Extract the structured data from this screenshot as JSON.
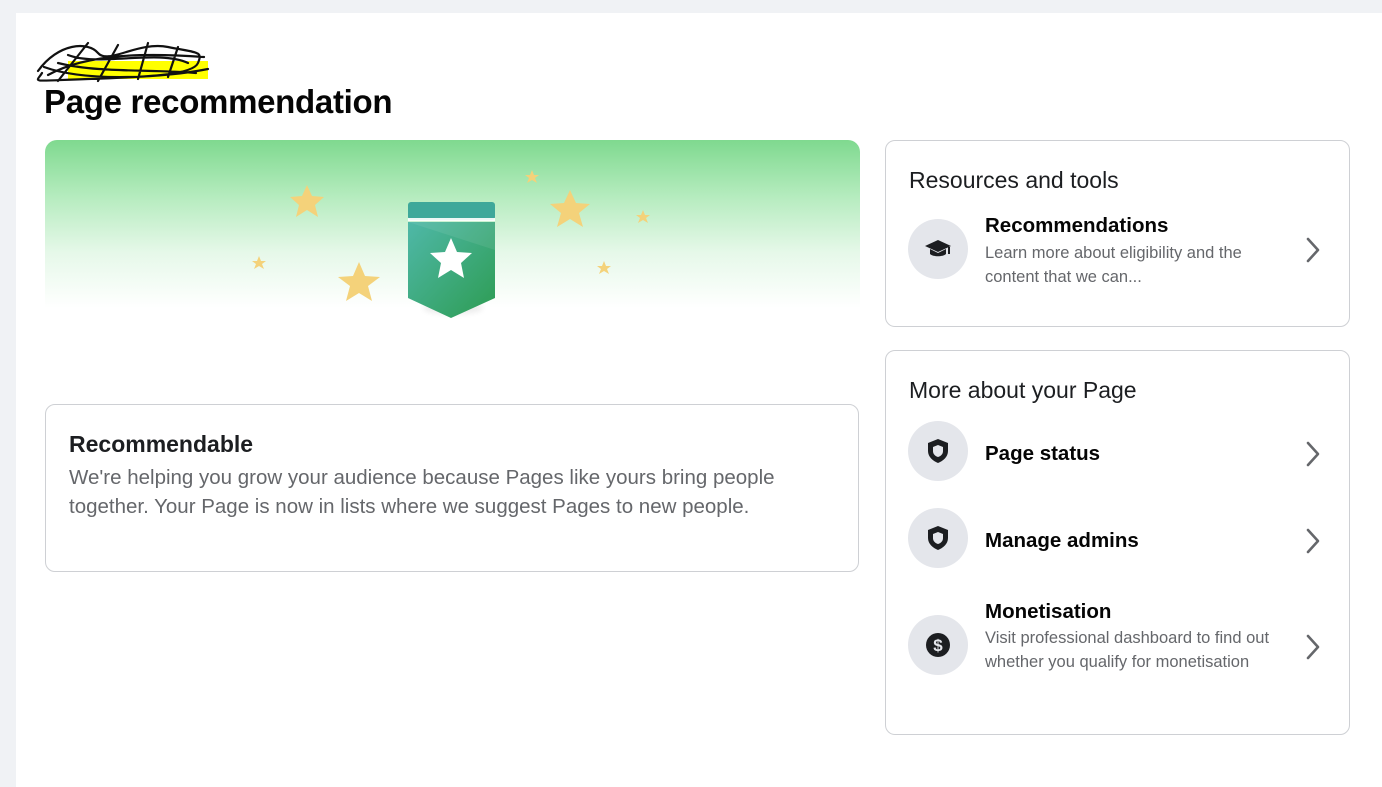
{
  "page": {
    "title": "Page recommendation"
  },
  "status_card": {
    "heading": "Recommendable",
    "body": "We're helping you grow your audience because Pages like yours bring people together. Your Page is now in lists where we suggest Pages to new people."
  },
  "resources": {
    "heading": "Resources and tools",
    "items": [
      {
        "title": "Recommendations",
        "description": "Learn more about eligibility and the content that we can...",
        "icon": "graduation-cap-icon"
      }
    ]
  },
  "more": {
    "heading": "More about your Page",
    "items": [
      {
        "title": "Page status",
        "icon": "shield-icon"
      },
      {
        "title": "Manage admins",
        "icon": "shield-icon"
      },
      {
        "title": "Monetisation",
        "description": "Visit professional dashboard to find out whether you qualify for monetisation",
        "icon": "dollar-icon"
      }
    ]
  },
  "colors": {
    "badge_teal": "#3fb0a0",
    "badge_green": "#2f9e52",
    "star_gold": "#f4d27a",
    "redaction_highlight": "#ffff00"
  }
}
